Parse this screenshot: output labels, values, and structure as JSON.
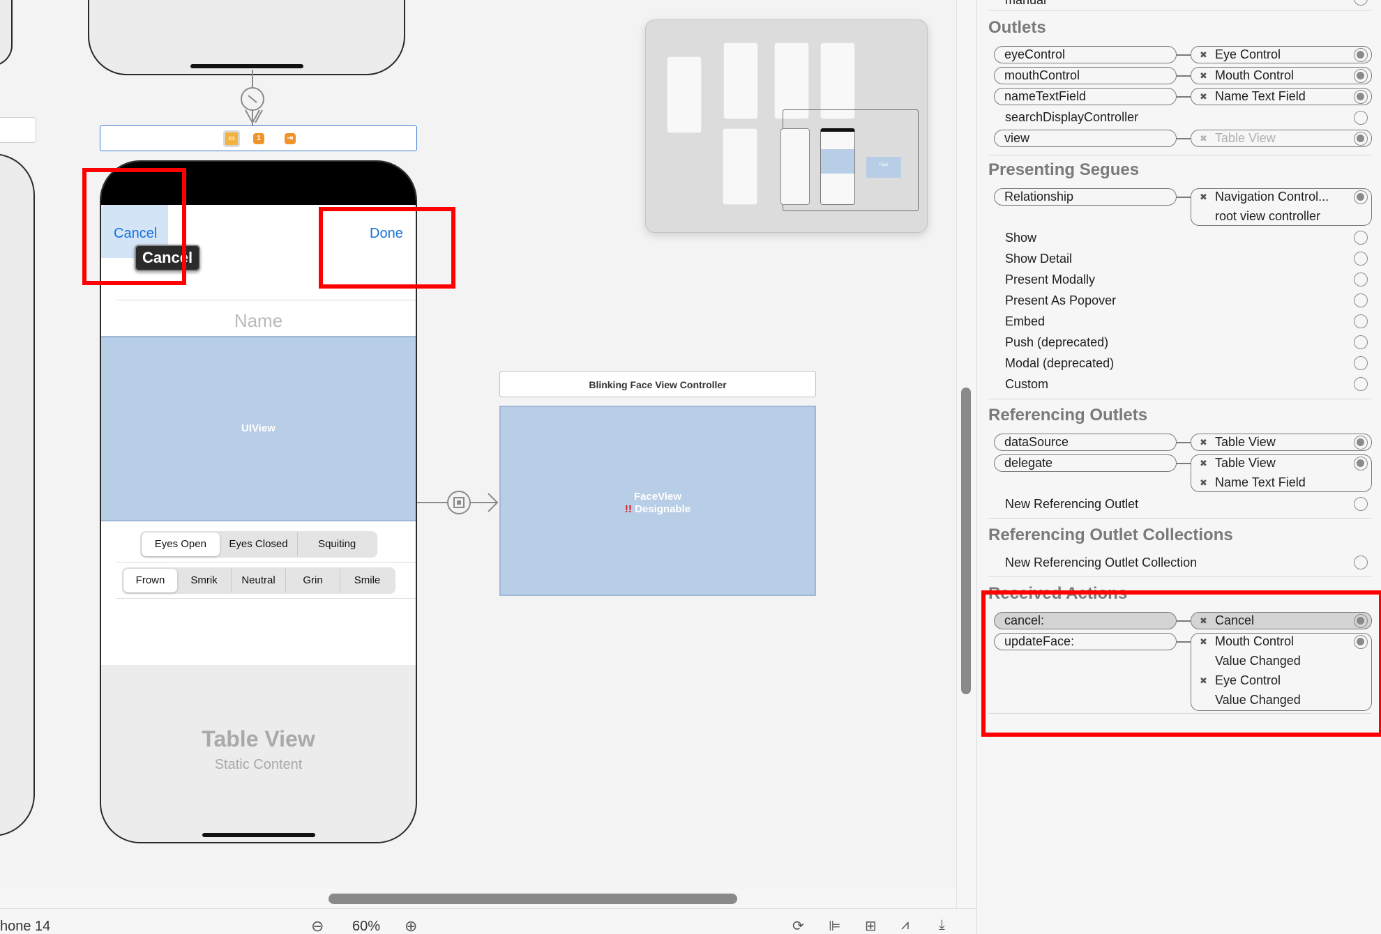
{
  "scene_header": {
    "badge_count": "1"
  },
  "phone_editor": {
    "cancel_label": "Cancel",
    "done_label": "Done",
    "tooltip_label": "Cancel",
    "name_placeholder": "Name",
    "uiview_label": "UIView",
    "eyes_segments": [
      "Eyes Open",
      "Eyes Closed",
      "Squiting"
    ],
    "eyes_selected": "Eyes Open",
    "mouth_segments": [
      "Frown",
      "Smrik",
      "Neutral",
      "Grin",
      "Smile"
    ],
    "mouth_selected": "Frown",
    "table_title": "Table View",
    "table_subtitle": "Static Content"
  },
  "face_controller": {
    "title": "Blinking Face View Controller",
    "view_label": "FaceView",
    "warning_marks": "!!",
    "status": "Designable"
  },
  "minimap": {
    "thumb_text": "Face"
  },
  "inspector": {
    "top_cut_text": "manual",
    "outlets": {
      "title": "Outlets",
      "rows": [
        {
          "name": "eyeControl",
          "target": "Eye Control",
          "connected": true
        },
        {
          "name": "mouthControl",
          "target": "Mouth Control",
          "connected": true
        },
        {
          "name": "nameTextField",
          "target": "Name Text Field",
          "connected": true
        },
        {
          "name": "searchDisplayController",
          "target": "",
          "connected": false
        },
        {
          "name": "view",
          "target": "Table View",
          "connected": true,
          "dimmed": true
        }
      ]
    },
    "presenting_segues": {
      "title": "Presenting Segues",
      "relationship": {
        "name": "Relationship",
        "target": "Navigation Control...",
        "detail": "root view controller"
      },
      "items": [
        "Show",
        "Show Detail",
        "Present Modally",
        "Present As Popover",
        "Embed",
        "Push (deprecated)",
        "Modal (deprecated)",
        "Custom"
      ]
    },
    "referencing_outlets": {
      "title": "Referencing Outlets",
      "datasource": {
        "name": "dataSource",
        "target": "Table View"
      },
      "delegate": {
        "name": "delegate",
        "targets": [
          "Table View",
          "Name Text Field"
        ]
      },
      "new_label": "New Referencing Outlet"
    },
    "referencing_outlet_collections": {
      "title": "Referencing Outlet Collections",
      "new_label": "New Referencing Outlet Collection"
    },
    "received_actions": {
      "title": "Received Actions",
      "cancel": {
        "name": "cancel:",
        "target": "Cancel"
      },
      "update": {
        "name": "updateFace:",
        "targets": [
          {
            "control": "Mouth Control",
            "event": "Value Changed"
          },
          {
            "control": "Eye Control",
            "event": "Value Changed"
          }
        ]
      }
    }
  },
  "bottom_bar": {
    "device_label": "hone 14",
    "zoom_label": "60%"
  },
  "colors": {
    "accent": "#1570e0",
    "highlight": "#ff0000",
    "view_fill": "#b8cde6",
    "orange": "#f0932b"
  }
}
